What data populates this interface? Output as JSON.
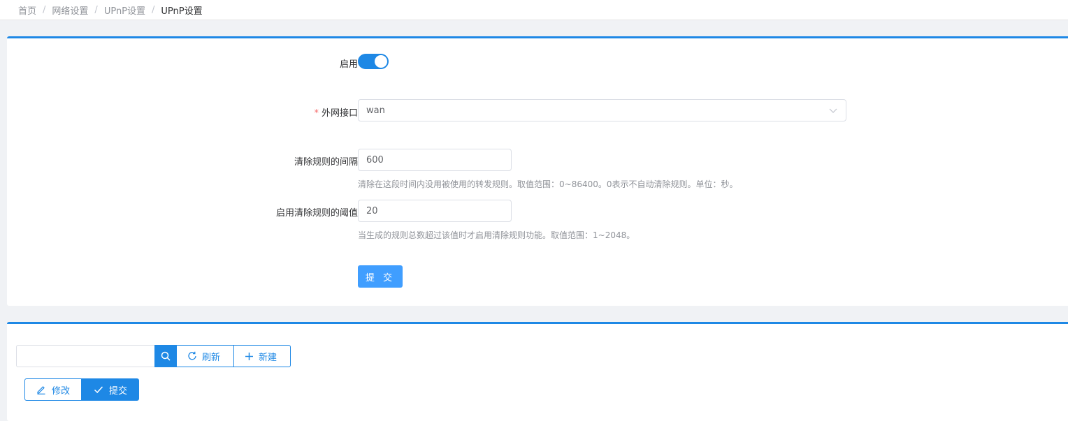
{
  "breadcrumb": [
    "首页",
    "网络设置",
    "UPnP设置",
    "UPnP设置"
  ],
  "form": {
    "enable_label": "启用",
    "enable_on": true,
    "wan_label": "外网接口",
    "wan_required_mark": "*",
    "wan_value": "wan",
    "clean_interval_label": "清除规则的间隔",
    "clean_interval_value": "600",
    "clean_interval_help": "清除在这段时间内没用被使用的转发规则。取值范围：0~86400。0表示不自动清除规则。单位：秒。",
    "clean_threshold_label": "启用清除规则的阈值",
    "clean_threshold_value": "20",
    "clean_threshold_help": "当生成的规则总数超过该值时才启用清除规则功能。取值范围：1~2048。",
    "submit_label": "提 交"
  },
  "toolbar": {
    "search_placeholder": "",
    "refresh_label": "刷新",
    "add_label": "新建"
  },
  "actions": {
    "edit_label": "修改",
    "commit_label": "提交"
  },
  "colors": {
    "accent": "#1e88e5",
    "primary_button": "#409eff",
    "required": "#f56c6c"
  },
  "icons": [
    "search-icon",
    "refresh-icon",
    "plus-icon",
    "edit-icon",
    "check-icon",
    "chevron-down-icon"
  ]
}
